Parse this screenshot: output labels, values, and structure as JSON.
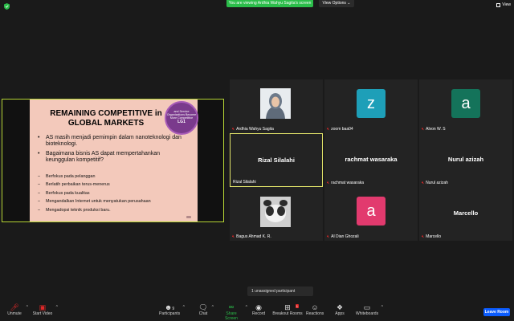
{
  "banner": {
    "text": "You are viewing Ardhia Wahyu Sagita's screen",
    "view_options": "View Options ⌄",
    "view": "View"
  },
  "slide": {
    "title": "REMAINING COMPETITIVE in GLOBAL MARKETS",
    "badge_text": "and Service Organizations Become More Competitive",
    "badge_code": "LG1",
    "bullets": [
      "AS masih menjadi pemimpin dalam nanoteknologi dan bioteknologi.",
      "Bagaimana bisnis AS dapat mempertahankan keunggulan kompetitif?"
    ],
    "sub_bullets": [
      "Berfokus pada pelanggan",
      "Berlatih perbaikan terus-menerus",
      "Berfokus pada kualitas",
      "Mengandalkan Internet untuk menyatukan perusahaan",
      "Mengadopsi teknik produksi baru."
    ]
  },
  "participants": [
    {
      "name": "Ardhia Wahyu Sagita",
      "type": "photo"
    },
    {
      "name": "zoom baa04",
      "type": "letter",
      "letter": "z",
      "color": "#1e9fb8"
    },
    {
      "name": "Alvon W. S",
      "type": "letter",
      "letter": "a",
      "color": "#14735a"
    },
    {
      "name": "Rizal Silalahi",
      "type": "text",
      "big": "Rizal Silalahi"
    },
    {
      "name": "rachmat wasaraka",
      "type": "text",
      "big": "rachmat wasaraka"
    },
    {
      "name": "Nurul azizah",
      "type": "text",
      "big": "Nurul azizah"
    },
    {
      "name": "Bagus Ahmad K. R.",
      "type": "photo2"
    },
    {
      "name": "Al Dian Ghozali",
      "type": "letter",
      "letter": "a",
      "color": "#e23a6e"
    },
    {
      "name": "Marcello",
      "type": "text",
      "big": "Marcello"
    }
  ],
  "toast": "1 unassigned participant",
  "toolbar": {
    "unmute": "Unmute",
    "start_video": "Start Video",
    "participants": "Participants",
    "participants_count": "9",
    "chat": "Chat",
    "share_screen": "Share Screen",
    "record": "Record",
    "breakout": "Breakout Rooms",
    "breakout_badge": "1",
    "reactions": "Reactions",
    "apps": "Apps",
    "whiteboards": "Whiteboards",
    "leave": "Leave Room"
  },
  "colors": {
    "accent_green": "#2bbd4a",
    "leave_blue": "#0b5cff",
    "active_border": "#e6e86b",
    "share_border": "#b5d334"
  }
}
